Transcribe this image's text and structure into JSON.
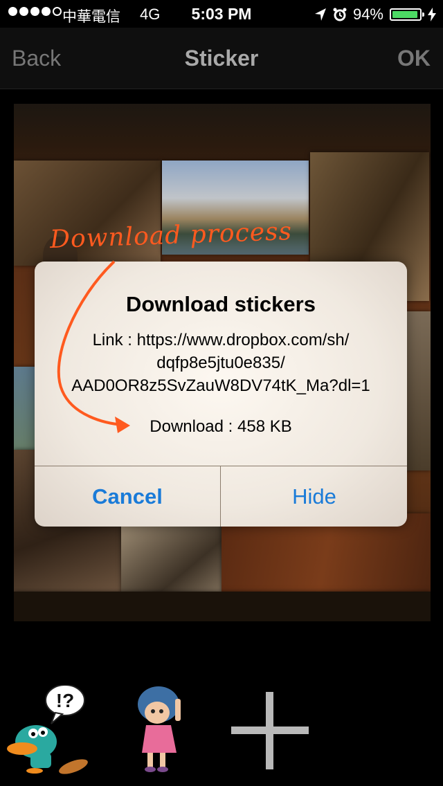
{
  "status_bar": {
    "carrier": "中華電信",
    "network": "4G",
    "time": "5:03 PM",
    "battery_percent": "94%",
    "battery_level": 0.94
  },
  "nav": {
    "back_label": "Back",
    "title": "Sticker",
    "ok_label": "OK"
  },
  "annotation": {
    "text": "Download process"
  },
  "dialog": {
    "title": "Download stickers",
    "link_lines": [
      "Link : https://www.dropbox.com/sh/",
      "dqfp8e5jtu0e835/",
      "AAD0OR8z5SvZauW8DV74tK_Ma?dl=1"
    ],
    "size_text": "Download : 458 KB",
    "cancel_label": "Cancel",
    "hide_label": "Hide"
  },
  "sticker_tray": {
    "bubble_text": "!?"
  },
  "colors": {
    "accent": "#1a7bd8",
    "annotation": "#ff5a1f",
    "battery": "#4cd964"
  }
}
